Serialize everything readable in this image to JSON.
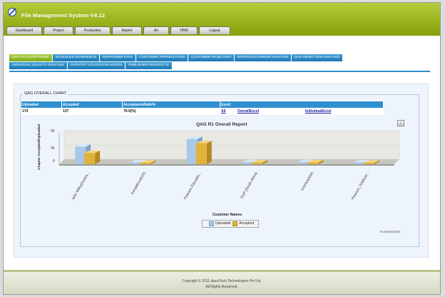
{
  "app": {
    "title": "File Management System-V4.12"
  },
  "nav": {
    "tabs": [
      {
        "label": "Dashboard",
        "w": 50
      },
      {
        "label": "Project",
        "w": 42
      },
      {
        "label": "Production",
        "w": 50
      },
      {
        "label": "Report",
        "w": 42
      },
      {
        "label": "Art",
        "w": 36
      },
      {
        "label": "HRM",
        "w": 38
      },
      {
        "label": "Logout",
        "w": 44
      }
    ]
  },
  "subnav": {
    "row1": [
      {
        "label": "QAG R1 ACCEPTANCE",
        "active": true
      },
      {
        "label": "SCHEDULE ADHERENCE"
      },
      {
        "label": "MANPOWER DATA"
      },
      {
        "label": "CUSTOMER APPRECIATION"
      },
      {
        "label": "CUSTOMER REJECTION"
      },
      {
        "label": "INPROCESS ERROR ANALYSIS"
      },
      {
        "label": "QAG REJECTION ANALYSIS"
      }
    ],
    "row2": [
      {
        "label": "INDIVIDUAL QUALITY ANALYSIS"
      },
      {
        "label": "CAPACITY UTILIZATION HOURS"
      },
      {
        "label": "PUBLISHER PROJECT IP"
      }
    ]
  },
  "panel": {
    "legend": "QAG OVERALL CHART"
  },
  "summary": {
    "headers": [
      "Uploaded",
      "Accepted",
      "AcceptanceRatio%",
      "Excel"
    ],
    "uploaded": "174",
    "accepted": "137",
    "ratio": "79.0(%)",
    "links": [
      "All",
      "OverallExcel",
      "IndividualExcel"
    ]
  },
  "chart_data": {
    "type": "bar",
    "title": "QAG R1 Overall Report",
    "xlabel": "Customer Names",
    "ylabel": "Chapter Accepted/Uploaded",
    "ylim": [
      0,
      90
    ],
    "yticks": [
      "90",
      "36",
      "0"
    ],
    "categories": [
      "John Wiley(Austra...",
      "Kendalhunt(US)",
      "Pearson Educatio...",
      "OUP (South Africa)",
      "Cosmos(Iost)",
      "Pearson_SA(Bust..."
    ],
    "series": [
      {
        "name": "Uploaded",
        "color": "#a9c8e8",
        "values": [
          50,
          5,
          72,
          6,
          6,
          5
        ]
      },
      {
        "name": "Accepted",
        "color": "#e0b23c",
        "values": [
          32,
          4,
          60,
          5,
          5,
          4
        ]
      }
    ],
    "credit": "FusionCharts"
  },
  "footer": {
    "line1": "Copyright © 2011 diacriTech Technologies Pvt Ltd.",
    "line2": "All Rights Reserved."
  },
  "colors": {
    "header": "#93ad16",
    "tab_blue": "#1d78b4",
    "tab_active": "#7fa81b",
    "uploaded": "#a9c8e8",
    "accepted": "#e0b23c"
  }
}
